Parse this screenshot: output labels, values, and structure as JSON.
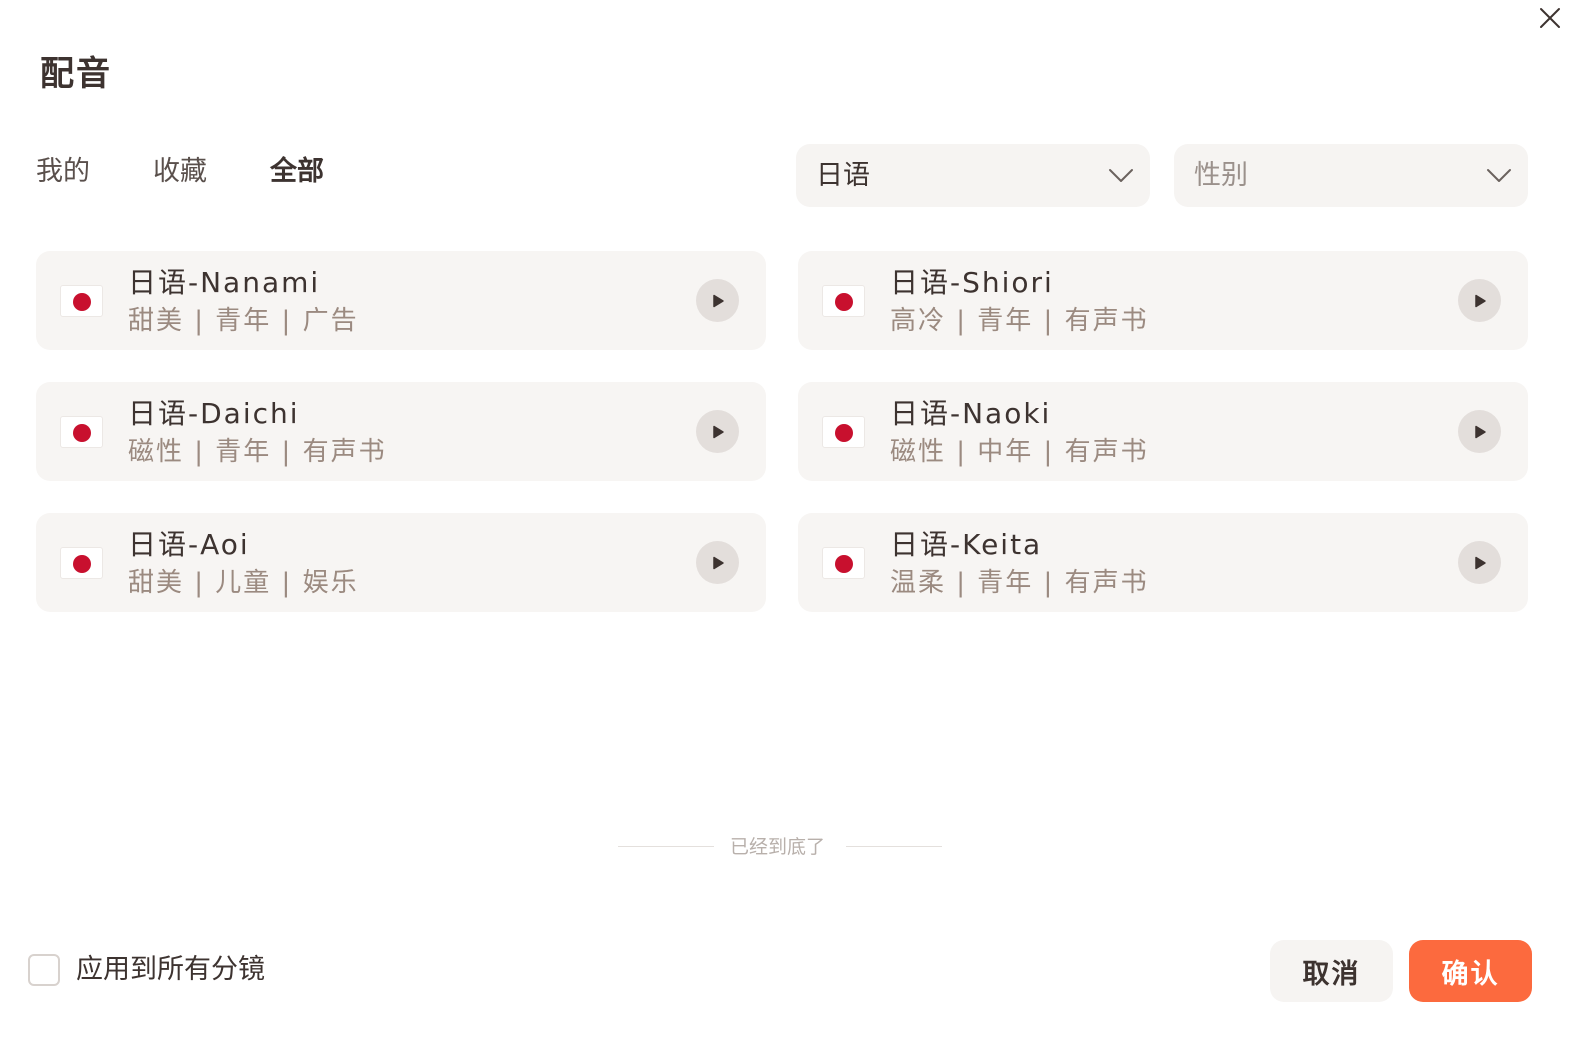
{
  "dialog": {
    "title": "配音"
  },
  "tabs": [
    {
      "label": "我的",
      "active": false
    },
    {
      "label": "收藏",
      "active": false
    },
    {
      "label": "全部",
      "active": true
    }
  ],
  "filters": {
    "language": {
      "value": "日语"
    },
    "gender": {
      "placeholder": "性别"
    }
  },
  "voices": [
    {
      "name": "日语-Nanami",
      "tags": "甜美 | 青年 | 广告",
      "flag": "japan-flag"
    },
    {
      "name": "日语-Shiori",
      "tags": "高冷 | 青年 | 有声书",
      "flag": "japan-flag"
    },
    {
      "name": "日语-Daichi",
      "tags": "磁性 | 青年 | 有声书",
      "flag": "japan-flag"
    },
    {
      "name": "日语-Naoki",
      "tags": "磁性 | 中年 | 有声书",
      "flag": "japan-flag"
    },
    {
      "name": "日语-Aoi",
      "tags": "甜美 | 儿童 | 娱乐",
      "flag": "japan-flag"
    },
    {
      "name": "日语-Keita",
      "tags": "温柔 | 青年 | 有声书",
      "flag": "japan-flag"
    }
  ],
  "list_end_text": "已经到底了",
  "footer": {
    "apply_all_label": "应用到所有分镜",
    "apply_all_checked": false,
    "cancel_label": "取消",
    "confirm_label": "确认"
  },
  "colors": {
    "accent": "#fc6a3e",
    "card_bg": "#f7f5f3",
    "text": "#3d3330",
    "tag_text": "#9b8a80",
    "flag_red": "#c8102e"
  },
  "icons": {
    "close": "close-icon",
    "dropdown": "chevron-down-icon",
    "play": "play-icon"
  }
}
